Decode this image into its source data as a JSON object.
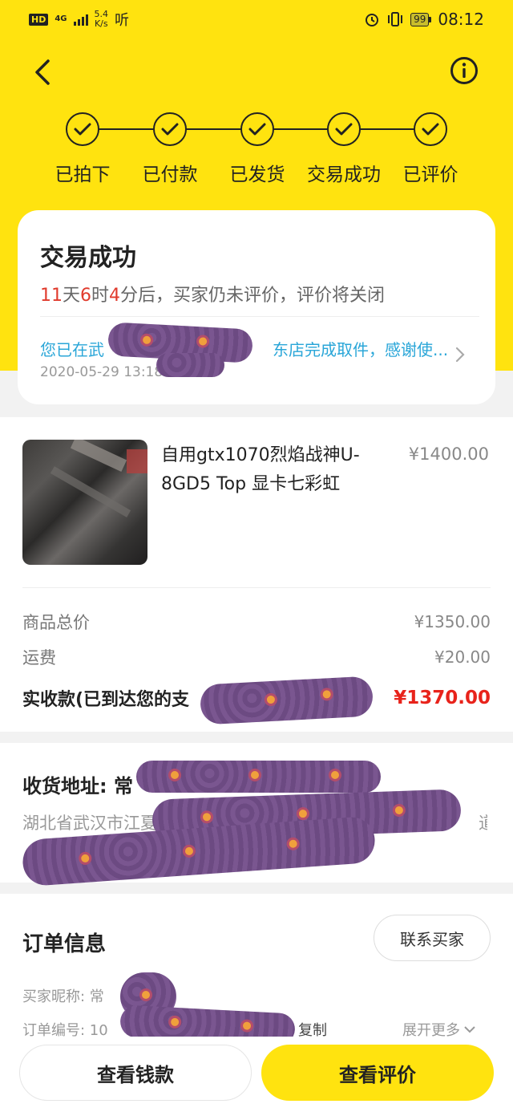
{
  "status_bar": {
    "hd": "HD",
    "network": "4G",
    "speed_value": "5.4",
    "speed_unit": "K/s",
    "listen": "听",
    "battery": "99",
    "time": "08:12"
  },
  "steps": [
    {
      "label": "已拍下"
    },
    {
      "label": "已付款"
    },
    {
      "label": "已发货"
    },
    {
      "label": "交易成功"
    },
    {
      "label": "已评价"
    }
  ],
  "status_card": {
    "title": "交易成功",
    "countdown": {
      "days": "11",
      "days_unit": "天",
      "hours": "6",
      "hours_unit": "时",
      "minutes": "4",
      "minutes_tail": "分后，买家仍未评价，评价将关闭"
    },
    "pickup_prefix": "您已在武",
    "pickup_suffix": "东店完成取件，感谢使...",
    "pickup_date": "2020-05-29 13:18:"
  },
  "product": {
    "title": "自用gtx1070烈焰战神U-8GD5 Top 显卡七彩虹",
    "price": "¥1400.00"
  },
  "summary": {
    "goods_total_label": "商品总价",
    "goods_total_value": "¥1350.00",
    "shipping_label": "运费",
    "shipping_value": "¥20.00",
    "received_label": "实收款(已到达您的支",
    "received_value": "¥1370.00"
  },
  "address": {
    "label": "收货地址:",
    "name_partial": "常",
    "text_prefix": "湖北省武汉市江夏区",
    "text_suffix": "道"
  },
  "order_info": {
    "title": "订单信息",
    "contact_button": "联系买家",
    "nickname": "买家昵称: 常",
    "order_no": "订单编号: 10",
    "copy": "复制",
    "expand": "展开更多"
  },
  "bottom": {
    "money_button": "查看钱款",
    "review_button": "查看评价"
  },
  "colors": {
    "brand_yellow": "#ffe30f",
    "price_red": "#e8231b",
    "link_blue": "#2aa6d8"
  }
}
